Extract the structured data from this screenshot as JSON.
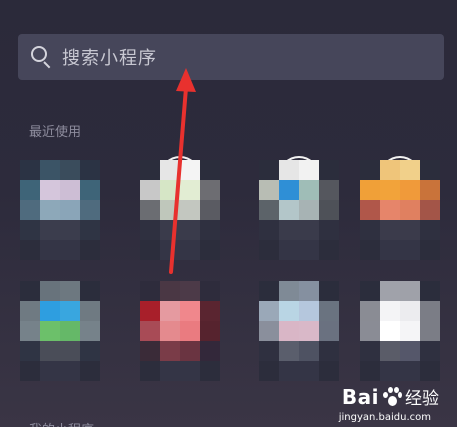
{
  "search": {
    "placeholder": "搜索小程序",
    "icon": "search-icon"
  },
  "recent_section": {
    "title": "最近使用"
  },
  "my_section": {
    "title": "我的小程序"
  },
  "watermark": {
    "brand": "Bai",
    "suffix": "经验",
    "url": "jingyan.baidu.com"
  },
  "annotation": {
    "arrow_color": "#e8312e"
  },
  "apps_row1": [
    {
      "name": "app-1",
      "palette": [
        "#2b3344",
        "#3b5466",
        "#3a4c5c",
        "#2b3344",
        "#3e6478",
        "#d5c6dc",
        "#cdbed5",
        "#3e6478",
        "#4f6b7e",
        "#8da8b9",
        "#8aa5b8",
        "#4f6b7e",
        "#2f3444",
        "#3b3d4d",
        "#3b3d4d",
        "#2f3444",
        "#2c2d3c",
        "#343546",
        "#343546",
        "#2c2d3c"
      ]
    },
    {
      "name": "app-2",
      "palette": [
        "#2b2d3c",
        "#e6e6e6",
        "#f4f4f4",
        "#2b2d3c",
        "#c8c8c8",
        "#d6e6c6",
        "#e2edd3",
        "#6d6d72",
        "#6b6d72",
        "#bfc7bb",
        "#c3c7c0",
        "#5a5b62",
        "#2f3040",
        "#3a3b4b",
        "#3a3b4b",
        "#2f3040",
        "#2c2d3c",
        "#343546",
        "#343546",
        "#2c2d3c"
      ]
    },
    {
      "name": "app-3",
      "palette": [
        "#2b2d3c",
        "#e6e6e6",
        "#f2f2f2",
        "#2b2d3c",
        "#b8bdb4",
        "#2f8fd6",
        "#9fbdb7",
        "#55575e",
        "#5c6369",
        "#b3c6c9",
        "#a7b3b4",
        "#4e5158",
        "#2f3040",
        "#3a3b4b",
        "#3a3b4b",
        "#2f3040",
        "#2c2d3c",
        "#343546",
        "#343546",
        "#2c2d3c"
      ]
    },
    {
      "name": "app-4",
      "palette": [
        "#2b2d3c",
        "#efc57a",
        "#f1d08a",
        "#2b2d3c",
        "#f0a038",
        "#f2a33a",
        "#f09a3a",
        "#c9733a",
        "#b0574a",
        "#e6856a",
        "#e08060",
        "#a35548",
        "#2f3040",
        "#3b3b4b",
        "#3b3b4b",
        "#2f3040",
        "#2c2d3c",
        "#343546",
        "#343546",
        "#2c2d3c"
      ]
    }
  ],
  "apps_row2": [
    {
      "name": "app-5",
      "palette": [
        "#2b2d3c",
        "#68737c",
        "#6d7880",
        "#2b2d3c",
        "#6f7a82",
        "#2e9ee0",
        "#39a6df",
        "#6f7a82",
        "#76828a",
        "#6cc06a",
        "#65b868",
        "#76828a",
        "#2f3444",
        "#4a4d58",
        "#4a4d58",
        "#2f3444",
        "#2c2d3c",
        "#343546",
        "#343546",
        "#2c2d3c"
      ]
    },
    {
      "name": "app-6",
      "palette": [
        "#2e2c3c",
        "#4a3744",
        "#4c3a48",
        "#2e2c3c",
        "#a81f2a",
        "#e59aa0",
        "#f0878c",
        "#5a2530",
        "#a84b56",
        "#e48a8e",
        "#ea7b80",
        "#56232e",
        "#3a2b38",
        "#7a3c48",
        "#6a3441",
        "#33283a",
        "#2c2d3c",
        "#343546",
        "#343546",
        "#2c2d3c"
      ]
    },
    {
      "name": "app-7",
      "palette": [
        "#2b2d3c",
        "#7f8a96",
        "#8590a0",
        "#2b2d3c",
        "#9aa8b8",
        "#b9d5e4",
        "#b5c7dd",
        "#6a7380",
        "#8a8f9c",
        "#d9b6c6",
        "#d9b8c8",
        "#6a7180",
        "#2f3040",
        "#5a5e6c",
        "#4e5262",
        "#2f3040",
        "#2c2d3c",
        "#343546",
        "#343546",
        "#2c2d3c"
      ]
    },
    {
      "name": "app-8",
      "palette": [
        "#2b2d3c",
        "#a0a2aa",
        "#9fa1a9",
        "#2b2d3c",
        "#8a8c94",
        "#f4f4f6",
        "#ececef",
        "#7b7d86",
        "#8a8c95",
        "#ffffff",
        "#f5f5f7",
        "#7b7d86",
        "#2f3040",
        "#5a5c68",
        "#55576a",
        "#2f3040",
        "#2c2d3c",
        "#343546",
        "#343546",
        "#2c2d3c"
      ]
    }
  ]
}
